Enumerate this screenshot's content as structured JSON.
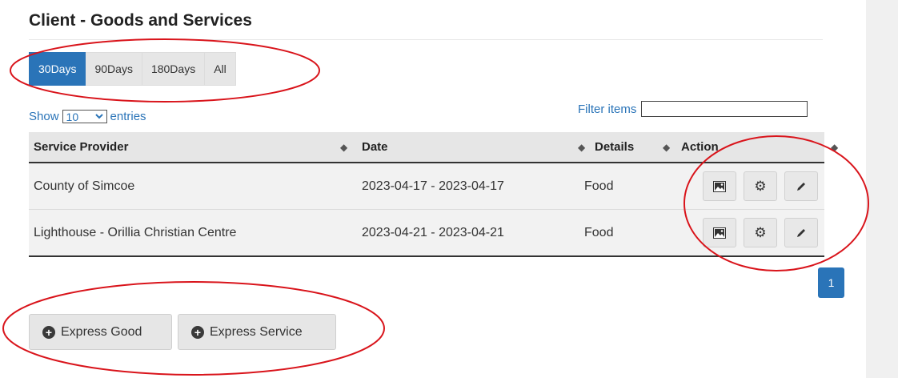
{
  "page": {
    "title": "Client - Goods and Services"
  },
  "tabs": [
    {
      "label": "30Days",
      "active": true
    },
    {
      "label": "90Days",
      "active": false
    },
    {
      "label": "180Days",
      "active": false
    },
    {
      "label": "All",
      "active": false
    }
  ],
  "length_menu": {
    "show_label": "Show",
    "value": "10",
    "entries_label": "entries"
  },
  "filter": {
    "label": "Filter items",
    "value": ""
  },
  "table": {
    "columns": [
      "Service Provider",
      "Date",
      "Details",
      "Action"
    ],
    "rows": [
      {
        "provider": "County of Simcoe",
        "date": "2023-04-17 - 2023-04-17",
        "details": "Food"
      },
      {
        "provider": "Lighthouse - Orillia Christian Centre",
        "date": "2023-04-21 - 2023-04-21",
        "details": "Food"
      }
    ],
    "row_actions": [
      "image-icon",
      "gear-icon",
      "pencil-icon"
    ]
  },
  "pagination": {
    "current_page": "1"
  },
  "buttons": {
    "express_good": "Express Good",
    "express_service": "Express Service"
  },
  "colors": {
    "accent": "#2a74b8",
    "annotation": "#d9141b"
  }
}
